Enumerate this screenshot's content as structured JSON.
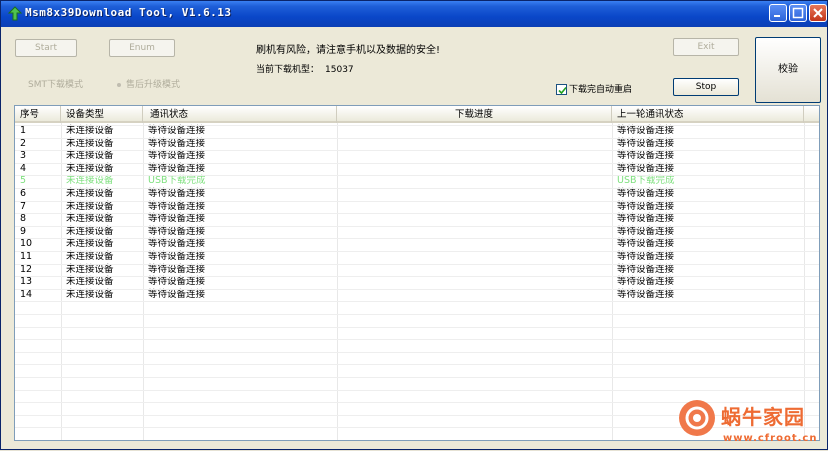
{
  "window": {
    "title": "Msm8x39Download Tool, V1.6.13"
  },
  "toolbar": {
    "start_label": "Start",
    "enum_label": "Enum",
    "exit_label": "Exit",
    "stop_label": "Stop",
    "verify_label": "校验"
  },
  "mode": {
    "smt_label": "SMT下载模式",
    "after_sales_label": "售后升级模式"
  },
  "info": {
    "warning": "刷机有风险，请注意手机以及数据的安全!",
    "model_label": "当前下载机型：",
    "model_value": "15037",
    "auto_restart_label": "下载完自动重启",
    "auto_restart_checked": true
  },
  "table": {
    "columns": [
      "序号",
      "设备类型",
      "通讯状态",
      "下载进度",
      "上一轮通讯状态"
    ],
    "rows": [
      {
        "index": "1",
        "device": "未连接设备",
        "status": "等待设备连接",
        "progress": "",
        "last": "等待设备连接"
      },
      {
        "index": "2",
        "device": "未连接设备",
        "status": "等待设备连接",
        "progress": "",
        "last": "等待设备连接"
      },
      {
        "index": "3",
        "device": "未连接设备",
        "status": "等待设备连接",
        "progress": "",
        "last": "等待设备连接"
      },
      {
        "index": "4",
        "device": "未连接设备",
        "status": "等待设备连接",
        "progress": "",
        "last": "等待设备连接"
      },
      {
        "index": "5",
        "device": "未连接设备",
        "status": "USB下载完成",
        "progress": "",
        "last": "USB下载完成"
      },
      {
        "index": "6",
        "device": "未连接设备",
        "status": "等待设备连接",
        "progress": "",
        "last": "等待设备连接"
      },
      {
        "index": "7",
        "device": "未连接设备",
        "status": "等待设备连接",
        "progress": "",
        "last": "等待设备连接"
      },
      {
        "index": "8",
        "device": "未连接设备",
        "status": "等待设备连接",
        "progress": "",
        "last": "等待设备连接"
      },
      {
        "index": "9",
        "device": "未连接设备",
        "status": "等待设备连接",
        "progress": "",
        "last": "等待设备连接"
      },
      {
        "index": "10",
        "device": "未连接设备",
        "status": "等待设备连接",
        "progress": "",
        "last": "等待设备连接"
      },
      {
        "index": "11",
        "device": "未连接设备",
        "status": "等待设备连接",
        "progress": "",
        "last": "等待设备连接"
      },
      {
        "index": "12",
        "device": "未连接设备",
        "status": "等待设备连接",
        "progress": "",
        "last": "等待设备连接"
      },
      {
        "index": "13",
        "device": "未连接设备",
        "status": "等待设备连接",
        "progress": "",
        "last": "等待设备连接"
      },
      {
        "index": "14",
        "device": "未连接设备",
        "status": "等待设备连接",
        "progress": "",
        "last": "等待设备连接"
      }
    ],
    "highlight_row": "5",
    "highlight_color": "#7fe07f"
  },
  "watermark": {
    "text": "蜗牛家园",
    "url": "www.cfroot.cn",
    "color": "#ee6b33"
  }
}
